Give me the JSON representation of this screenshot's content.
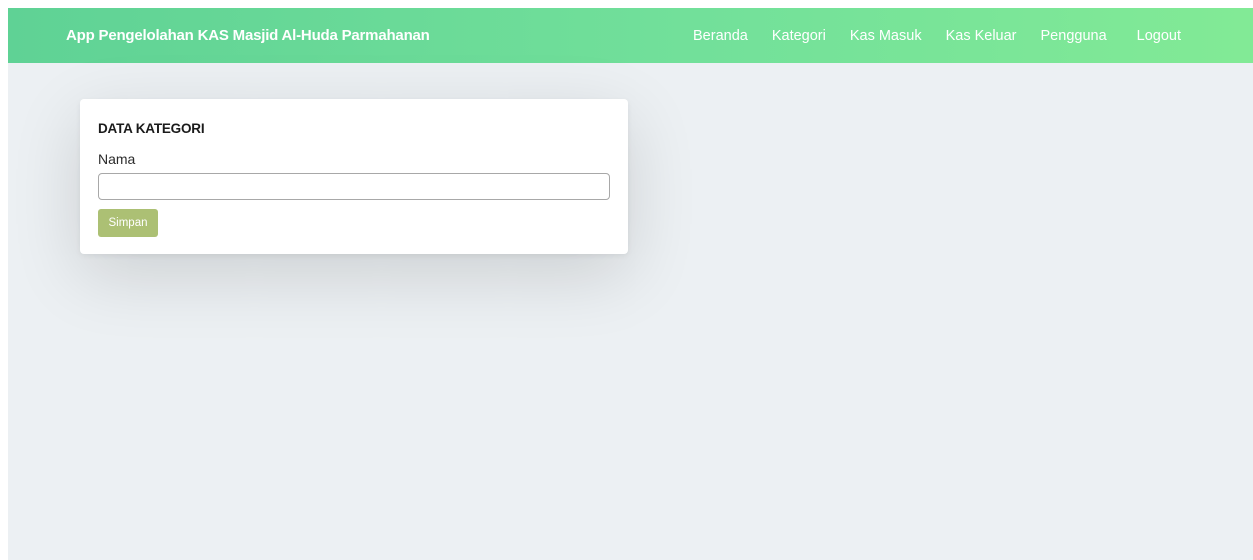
{
  "navbar": {
    "brand": "App Pengelolahan KAS Masjid Al-Huda Parmahanan",
    "items": [
      {
        "label": "Beranda"
      },
      {
        "label": "Kategori"
      },
      {
        "label": "Kas Masuk"
      },
      {
        "label": "Kas Keluar"
      },
      {
        "label": "Pengguna"
      }
    ],
    "logout_label": "Logout"
  },
  "form": {
    "title": "DATA KATEGORI",
    "name_label": "Nama",
    "name_value": "",
    "name_placeholder": "",
    "save_label": "Simpan"
  },
  "colors": {
    "navbar_gradient_start": "#5fd295",
    "navbar_gradient_end": "#82ea96",
    "page_background": "#ecf0f3",
    "save_button": "#acc074"
  }
}
